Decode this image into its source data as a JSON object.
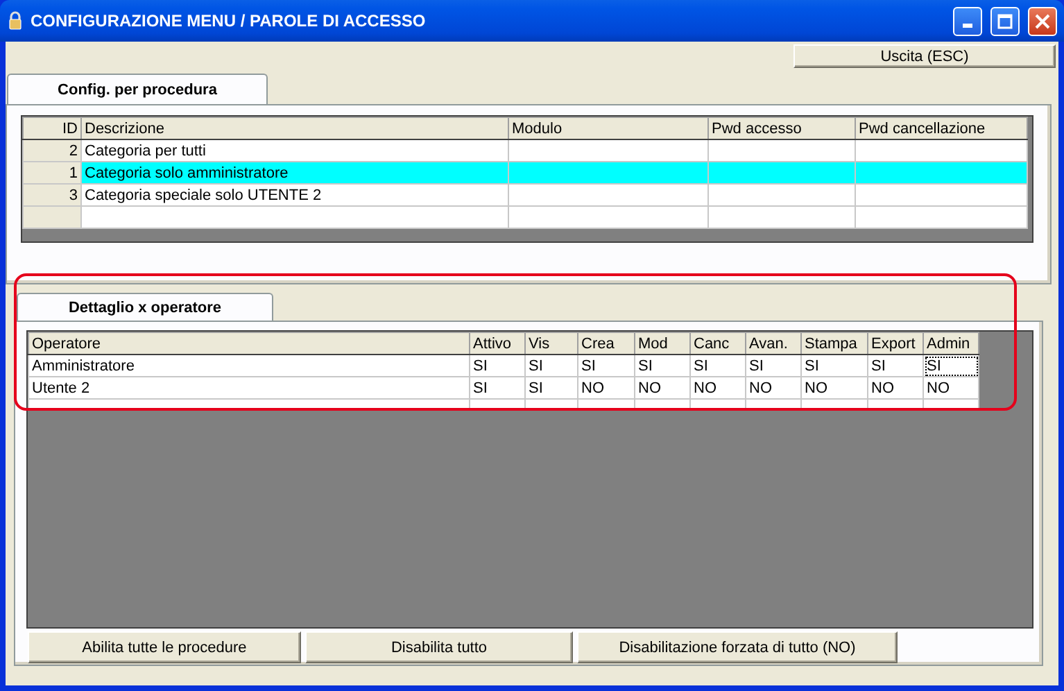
{
  "window": {
    "title": "CONFIGURAZIONE MENU / PAROLE DI ACCESSO"
  },
  "exit_button": "Uscita (ESC)",
  "procedure_tab": {
    "label": "Config. per procedura",
    "selected": true
  },
  "procedure_table": {
    "columns": [
      "ID",
      "Descrizione",
      "Modulo",
      "Pwd accesso",
      "Pwd cancellazione"
    ],
    "rows": [
      {
        "cells": [
          "2",
          "Categoria per tutti",
          "",
          "",
          ""
        ],
        "selected": false
      },
      {
        "cells": [
          "1",
          "Categoria solo amministratore",
          "",
          "",
          ""
        ],
        "selected": true
      },
      {
        "cells": [
          "3",
          "Categoria speciale solo UTENTE 2",
          "",
          "",
          ""
        ],
        "selected": false
      },
      {
        "cells": [
          "",
          "",
          "",
          "",
          ""
        ],
        "selected": false
      }
    ]
  },
  "operator_tab": {
    "label": "Dettaglio x operatore",
    "selected": true,
    "highlighted": true
  },
  "operator_table": {
    "columns": [
      "Operatore",
      "Attivo",
      "Vis",
      "Crea",
      "Mod",
      "Canc",
      "Avan.",
      "Stampa",
      "Export",
      "Admin"
    ],
    "rows": [
      {
        "cells": [
          {
            "text": "Amministratore",
            "focused": false
          },
          {
            "text": "SI",
            "focused": false
          },
          {
            "text": "SI",
            "focused": false
          },
          {
            "text": "SI",
            "focused": false
          },
          {
            "text": "SI",
            "focused": false
          },
          {
            "text": "SI",
            "focused": false
          },
          {
            "text": "SI",
            "focused": false
          },
          {
            "text": "SI",
            "focused": false
          },
          {
            "text": "SI",
            "focused": false
          },
          {
            "text": "SI",
            "focused": true
          }
        ]
      },
      {
        "cells": [
          {
            "text": "Utente 2",
            "focused": false
          },
          {
            "text": "SI",
            "focused": false
          },
          {
            "text": "SI",
            "focused": false
          },
          {
            "text": "NO",
            "focused": false
          },
          {
            "text": "NO",
            "focused": false
          },
          {
            "text": "NO",
            "focused": false
          },
          {
            "text": "NO",
            "focused": false
          },
          {
            "text": "NO",
            "focused": false
          },
          {
            "text": "NO",
            "focused": false
          },
          {
            "text": "NO",
            "focused": false
          }
        ]
      }
    ]
  },
  "buttons": [
    "Abilita tutte le procedure",
    "Disabilita tutto",
    "Disabilitazione forzata di tutto (NO)"
  ]
}
